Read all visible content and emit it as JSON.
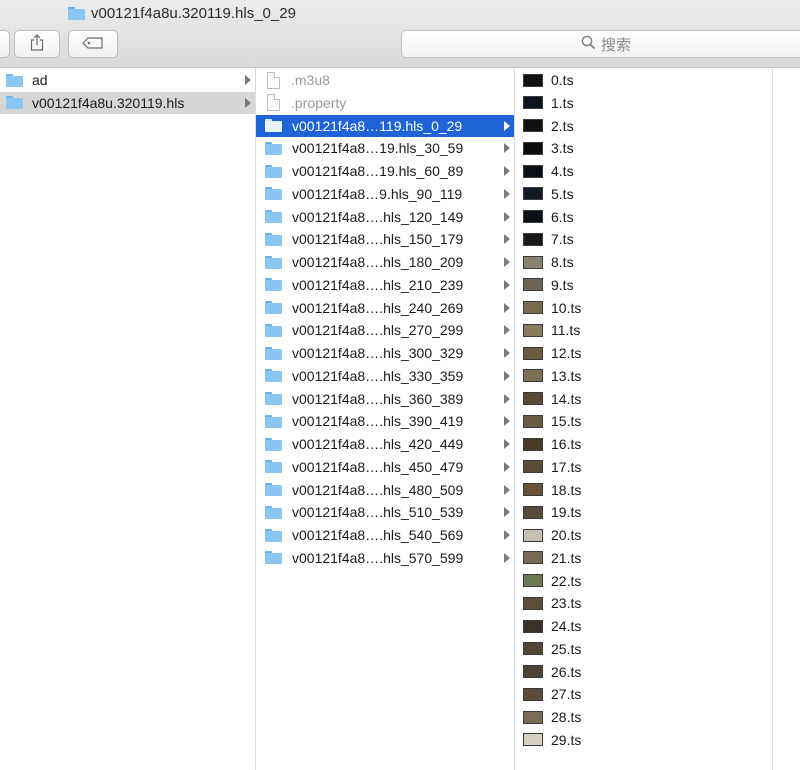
{
  "window": {
    "title": "v00121f4a8u.320119.hls_0_29"
  },
  "toolbar": {
    "share_icon": "share-icon",
    "tag_icon": "tag-icon"
  },
  "search": {
    "placeholder": "搜索"
  },
  "colors": {
    "selection": "#1f64d6",
    "folder": "#8ac6f2"
  },
  "column1": {
    "items": [
      {
        "label": "ad",
        "selected": false
      },
      {
        "label": "v00121f4a8u.320119.hls",
        "selected": true
      }
    ]
  },
  "column2": {
    "items": [
      {
        "label": ".m3u8",
        "kind": "file"
      },
      {
        "label": ".property",
        "kind": "file"
      },
      {
        "label": "v00121f4a8…119.hls_0_29",
        "kind": "folder",
        "active": true
      },
      {
        "label": "v00121f4a8…19.hls_30_59",
        "kind": "folder"
      },
      {
        "label": "v00121f4a8…19.hls_60_89",
        "kind": "folder"
      },
      {
        "label": "v00121f4a8…9.hls_90_119",
        "kind": "folder"
      },
      {
        "label": "v00121f4a8….hls_120_149",
        "kind": "folder"
      },
      {
        "label": "v00121f4a8….hls_150_179",
        "kind": "folder"
      },
      {
        "label": "v00121f4a8….hls_180_209",
        "kind": "folder"
      },
      {
        "label": "v00121f4a8….hls_210_239",
        "kind": "folder"
      },
      {
        "label": "v00121f4a8….hls_240_269",
        "kind": "folder"
      },
      {
        "label": "v00121f4a8….hls_270_299",
        "kind": "folder"
      },
      {
        "label": "v00121f4a8….hls_300_329",
        "kind": "folder"
      },
      {
        "label": "v00121f4a8….hls_330_359",
        "kind": "folder"
      },
      {
        "label": "v00121f4a8….hls_360_389",
        "kind": "folder"
      },
      {
        "label": "v00121f4a8….hls_390_419",
        "kind": "folder"
      },
      {
        "label": "v00121f4a8….hls_420_449",
        "kind": "folder"
      },
      {
        "label": "v00121f4a8….hls_450_479",
        "kind": "folder"
      },
      {
        "label": "v00121f4a8….hls_480_509",
        "kind": "folder"
      },
      {
        "label": "v00121f4a8….hls_510_539",
        "kind": "folder"
      },
      {
        "label": "v00121f4a8….hls_540_569",
        "kind": "folder"
      },
      {
        "label": "v00121f4a8….hls_570_599",
        "kind": "folder"
      }
    ]
  },
  "column3": {
    "items": [
      "0.ts",
      "1.ts",
      "2.ts",
      "3.ts",
      "4.ts",
      "5.ts",
      "6.ts",
      "7.ts",
      "8.ts",
      "9.ts",
      "10.ts",
      "11.ts",
      "12.ts",
      "13.ts",
      "14.ts",
      "15.ts",
      "16.ts",
      "17.ts",
      "18.ts",
      "19.ts",
      "20.ts",
      "21.ts",
      "22.ts",
      "23.ts",
      "24.ts",
      "25.ts",
      "26.ts",
      "27.ts",
      "28.ts",
      "29.ts"
    ],
    "thumb_colors": [
      "#111111",
      "#0d1420",
      "#101010",
      "#0c0c0c",
      "#0b1018",
      "#121a2a",
      "#0a0f18",
      "#1a1a1a",
      "#8a8270",
      "#6d6455",
      "#7a6a50",
      "#8a7a60",
      "#6a5a40",
      "#7f6f55",
      "#5a4a35",
      "#6b5b43",
      "#4a3a28",
      "#5c4c36",
      "#6a5238",
      "#5a4a3a",
      "#c8c0b0",
      "#7a6a55",
      "#6b7a55",
      "#5d4d3a",
      "#3a3226",
      "#544433",
      "#4e4232",
      "#5b4b38",
      "#7b6b55",
      "#d8d0c0"
    ]
  }
}
